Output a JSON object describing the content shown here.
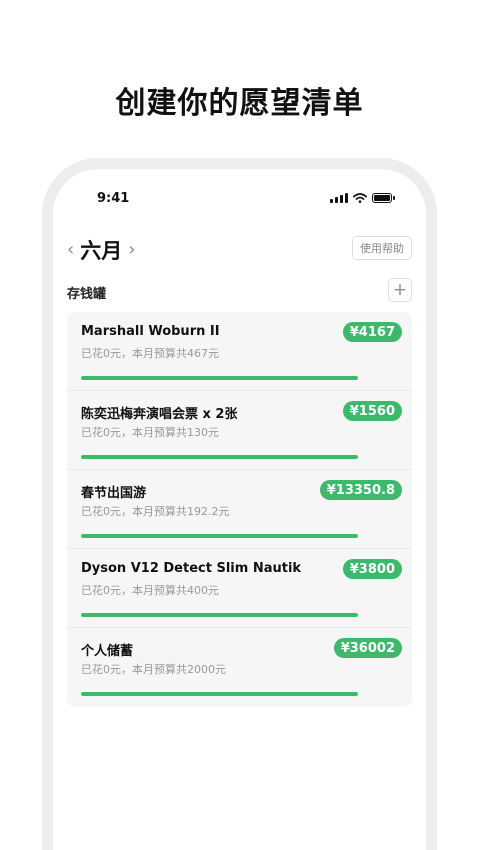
{
  "headline": "创建你的愿望清单",
  "status": {
    "time": "9:41"
  },
  "nav": {
    "prev": "‹",
    "month": "六月",
    "next": "›",
    "help_label": "使用帮助"
  },
  "section": {
    "title": "存钱罐",
    "add_label": "+"
  },
  "items": [
    {
      "name": "Marshall Woburn II",
      "subtitle": "已花0元，本月预算共467元",
      "amount": "¥4167",
      "progress_fraction": 1.0
    },
    {
      "name": "陈奕迅梅奔演唱会票 x 2张",
      "subtitle": "已花0元，本月预算共130元",
      "amount": "¥1560",
      "progress_fraction": 1.0
    },
    {
      "name": "春节出国游",
      "subtitle": "已花0元，本月预算共192.2元",
      "amount": "¥13350.8",
      "progress_fraction": 1.0
    },
    {
      "name": "Dyson V12 Detect Slim Nautik",
      "subtitle": "已花0元，本月预算共400元",
      "amount": "¥3800",
      "progress_fraction": 1.0
    },
    {
      "name": "个人储蓄",
      "subtitle": "已花0元，本月预算共2000元",
      "amount": "¥36002",
      "progress_fraction": 1.0
    }
  ],
  "colors": {
    "accent": "#3cb96a",
    "frame": "#ededed",
    "card": "#f6f6f6"
  }
}
